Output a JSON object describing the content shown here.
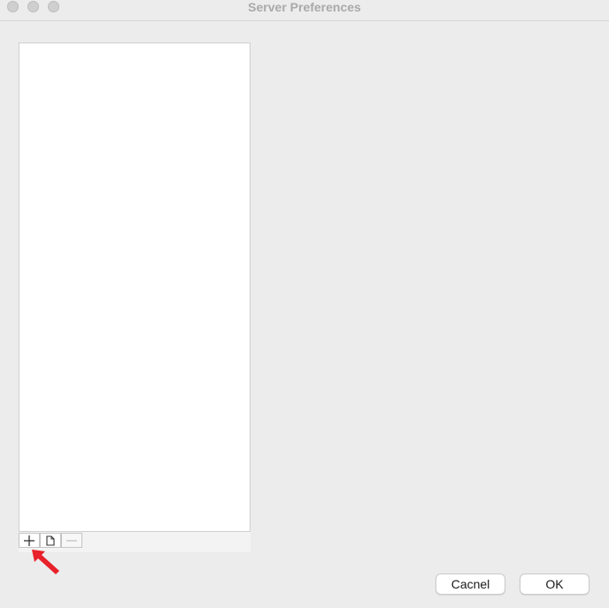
{
  "window": {
    "title": "Server Preferences"
  },
  "titlebar": {
    "buttons": [
      "close",
      "minimize",
      "zoom"
    ]
  },
  "server_list": {
    "items": []
  },
  "list_toolbar": {
    "add_icon": "plus-icon",
    "duplicate_icon": "document-icon",
    "remove_icon": "minus-icon"
  },
  "annotation": {
    "arrow_color": "#e8212b"
  },
  "footer": {
    "cancel_label": "Cacnel",
    "ok_label": "OK"
  }
}
